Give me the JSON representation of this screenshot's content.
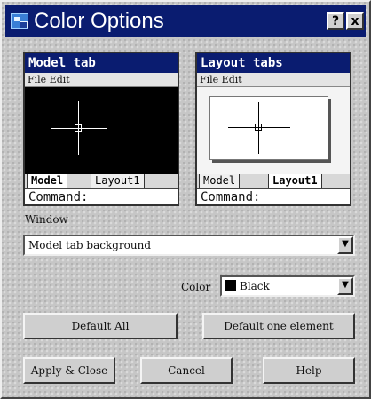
{
  "window": {
    "title": "Color Options",
    "help_glyph": "?",
    "close_glyph": "x"
  },
  "model_pane": {
    "title": "Model tab",
    "menu": "File  Edit",
    "tab_active": "Model",
    "tab_other": "Layout1",
    "command": "Command:",
    "background_color": "#000000",
    "crosshair_color": "#ffffff"
  },
  "layout_pane": {
    "title": "Layout tabs",
    "menu": "File  Edit",
    "tab_other": "Model",
    "tab_active": "Layout1",
    "command": "Command:",
    "crosshair_color": "#000000"
  },
  "window_section": {
    "label": "Window",
    "selected": "Model tab background",
    "arrow": "▼"
  },
  "color_section": {
    "label": "Color",
    "selected": "Black",
    "swatch": "#000000",
    "arrow": "▼"
  },
  "buttons": {
    "default_all": "Default All",
    "default_one": "Default one element",
    "apply_close": "Apply & Close",
    "cancel": "Cancel",
    "help": "Help"
  },
  "colors": {
    "title_bar": "#0a1c70",
    "dialog_bg": "#c6c6c6"
  }
}
